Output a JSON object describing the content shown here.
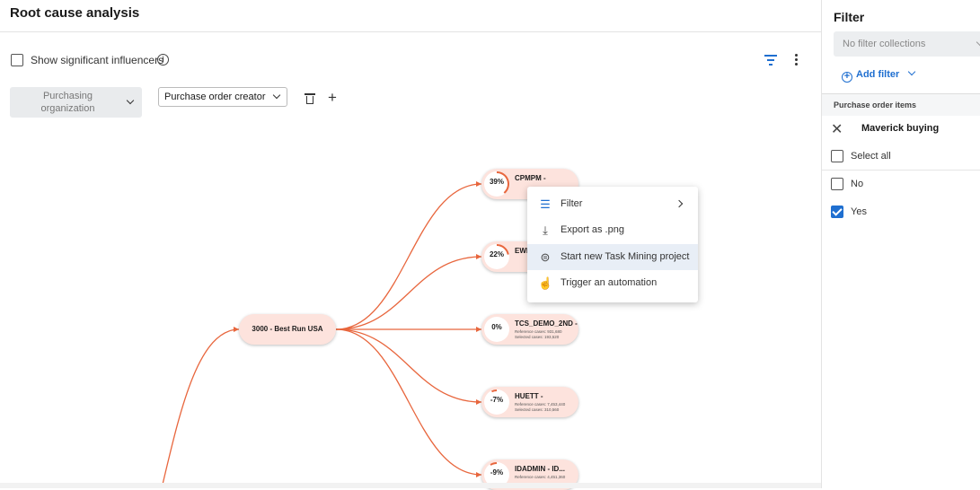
{
  "header": {
    "title": "Root cause analysis"
  },
  "toolbar": {
    "show_influencers_label": "Show significant influencers",
    "show_influencers_checked": false
  },
  "dimensions": [
    {
      "label": "Purchasing organization",
      "state": "disabled"
    },
    {
      "label": "Purchase order creator",
      "state": "active"
    }
  ],
  "graph": {
    "root": {
      "label": "3000 - Best Run USA"
    },
    "children": [
      {
        "pct": "39%",
        "value": 39,
        "name": "CPMPM -",
        "ref": "",
        "sel": ""
      },
      {
        "pct": "22%",
        "value": 22,
        "name": "EWM",
        "ref": "",
        "sel": ""
      },
      {
        "pct": "0%",
        "value": 0,
        "name": "TCS_DEMO_2ND -",
        "ref": "Reference cases: 931,680",
        "sel": "Selected cases: 193,520"
      },
      {
        "pct": "-7%",
        "value": -7,
        "name": "HUETT -",
        "ref": "Reference cases: 7,453,440",
        "sel": "Selected cases: 310,560"
      },
      {
        "pct": "-9%",
        "value": -9,
        "name": "IDADMIN - ID...",
        "ref": "Reference cases: 4,451,360",
        "sel": ""
      }
    ],
    "edge_color": "#e8663d"
  },
  "context_menu": {
    "items": [
      {
        "label": "Filter",
        "icon": "filter-icon",
        "submenu": true
      },
      {
        "label": "Export as .png",
        "icon": "download-icon"
      },
      {
        "label": "Start new Task Mining project",
        "icon": "task-mining-icon",
        "highlighted": true
      },
      {
        "label": "Trigger an automation",
        "icon": "touch-icon"
      }
    ]
  },
  "filter_panel": {
    "title": "Filter",
    "collections_placeholder": "No filter collections",
    "add_filter": "Add filter",
    "section": "Purchase order items",
    "filter_name": "Maverick buying",
    "options": [
      {
        "label": "Select all",
        "checked": false
      },
      {
        "label": "No",
        "checked": false
      },
      {
        "label": "Yes",
        "checked": true
      }
    ],
    "accent": "#1f6fd0"
  }
}
